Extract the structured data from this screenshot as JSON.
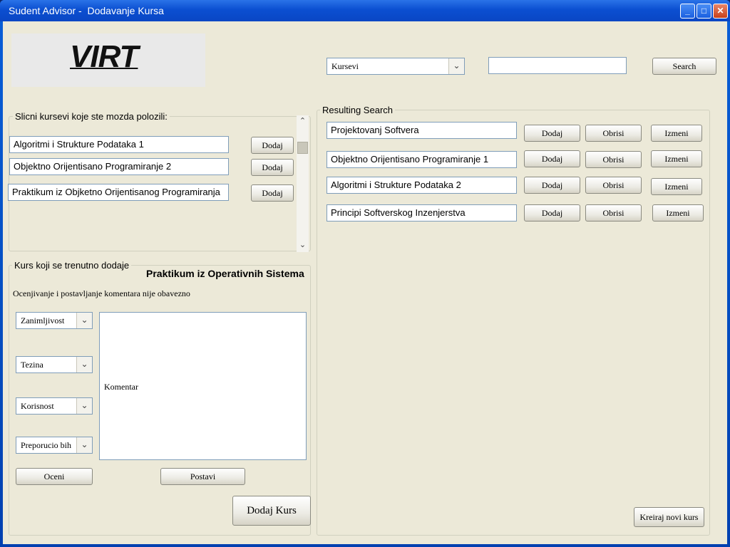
{
  "window": {
    "title": "Sudent Advisor -  Dodavanje Kursa",
    "minimize_glyph": "_",
    "maximize_glyph": "□",
    "close_glyph": "✕"
  },
  "logo": {
    "text": "VIRT"
  },
  "search": {
    "category": "Kursevi",
    "query": "",
    "button_label": "Search"
  },
  "similar": {
    "legend": "Slicni kursevi koje ste mozda polozili:",
    "items": [
      {
        "name": "Algoritmi i Strukture Podataka 1",
        "add_label": "Dodaj"
      },
      {
        "name": "Objektno Orijentisano Programiranje 2",
        "add_label": "Dodaj"
      },
      {
        "name": "Praktikum iz Objketno Orijentisanog Programiranja",
        "add_label": "Dodaj"
      }
    ]
  },
  "current": {
    "legend": "Kurs koji se trenutno dodaje",
    "course_name": "Praktikum iz Operativnih Sistema",
    "note": "Ocenjivanje i postavljanje komentara nije obavezno",
    "ratings": [
      "Zanimljivost",
      "Tezina",
      "Korisnost",
      "Preporucio bih"
    ],
    "comment": "Komentar",
    "rate_label": "Oceni",
    "post_label": "Postavi",
    "add_course_label": "Dodaj Kurs"
  },
  "results": {
    "legend": "Resulting Search",
    "items": [
      {
        "name": "Projektovanj Softvera",
        "add": "Dodaj",
        "delete": "Obrisi",
        "edit": "Izmeni"
      },
      {
        "name": "Objektno Orijentisano Programiranje 1",
        "add": "Dodaj",
        "delete": "Obrisi",
        "edit": "Izmeni"
      },
      {
        "name": "Algoritmi i Strukture Podataka 2",
        "add": "Dodaj",
        "delete": "Obrisi",
        "edit": "Izmeni"
      },
      {
        "name": "Principi Softverskog Inzenjerstva",
        "add": "Dodaj",
        "delete": "Obrisi",
        "edit": "Izmeni"
      }
    ],
    "create_label": "Kreiraj novi kurs"
  }
}
